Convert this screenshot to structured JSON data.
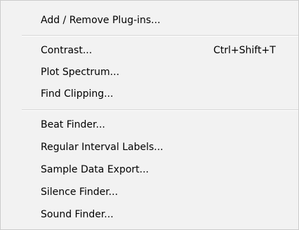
{
  "menu": {
    "items": [
      {
        "label": "Add / Remove Plug-ins...",
        "shortcut": ""
      },
      {
        "label": "Contrast...",
        "shortcut": "Ctrl+Shift+T"
      },
      {
        "label": "Plot Spectrum...",
        "shortcut": ""
      },
      {
        "label": "Find Clipping...",
        "shortcut": ""
      },
      {
        "label": "Beat Finder...",
        "shortcut": ""
      },
      {
        "label": "Regular Interval Labels...",
        "shortcut": ""
      },
      {
        "label": "Sample Data Export...",
        "shortcut": ""
      },
      {
        "label": "Silence Finder...",
        "shortcut": ""
      },
      {
        "label": "Sound Finder...",
        "shortcut": ""
      }
    ]
  }
}
